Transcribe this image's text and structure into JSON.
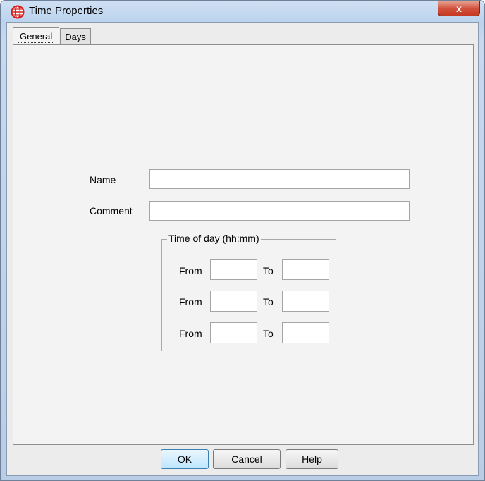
{
  "window": {
    "title": "Time Properties",
    "close_label": "x",
    "icon": "globe-icon"
  },
  "tabs": [
    {
      "label": "General",
      "active": true
    },
    {
      "label": "Days",
      "active": false
    }
  ],
  "form": {
    "name_label": "Name",
    "name_value": "",
    "comment_label": "Comment",
    "comment_value": "",
    "time_group": {
      "title": "Time of day (hh:mm)",
      "rows": [
        {
          "from_label": "From",
          "from_value": "",
          "to_label": "To",
          "to_value": ""
        },
        {
          "from_label": "From",
          "from_value": "",
          "to_label": "To",
          "to_value": ""
        },
        {
          "from_label": "From",
          "from_value": "",
          "to_label": "To",
          "to_value": ""
        }
      ]
    }
  },
  "buttons": {
    "ok": "OK",
    "cancel": "Cancel",
    "help": "Help"
  },
  "colors": {
    "close_button": "#c53a22",
    "default_button_border": "#3c7fb1",
    "icon_red": "#d81e1e"
  }
}
